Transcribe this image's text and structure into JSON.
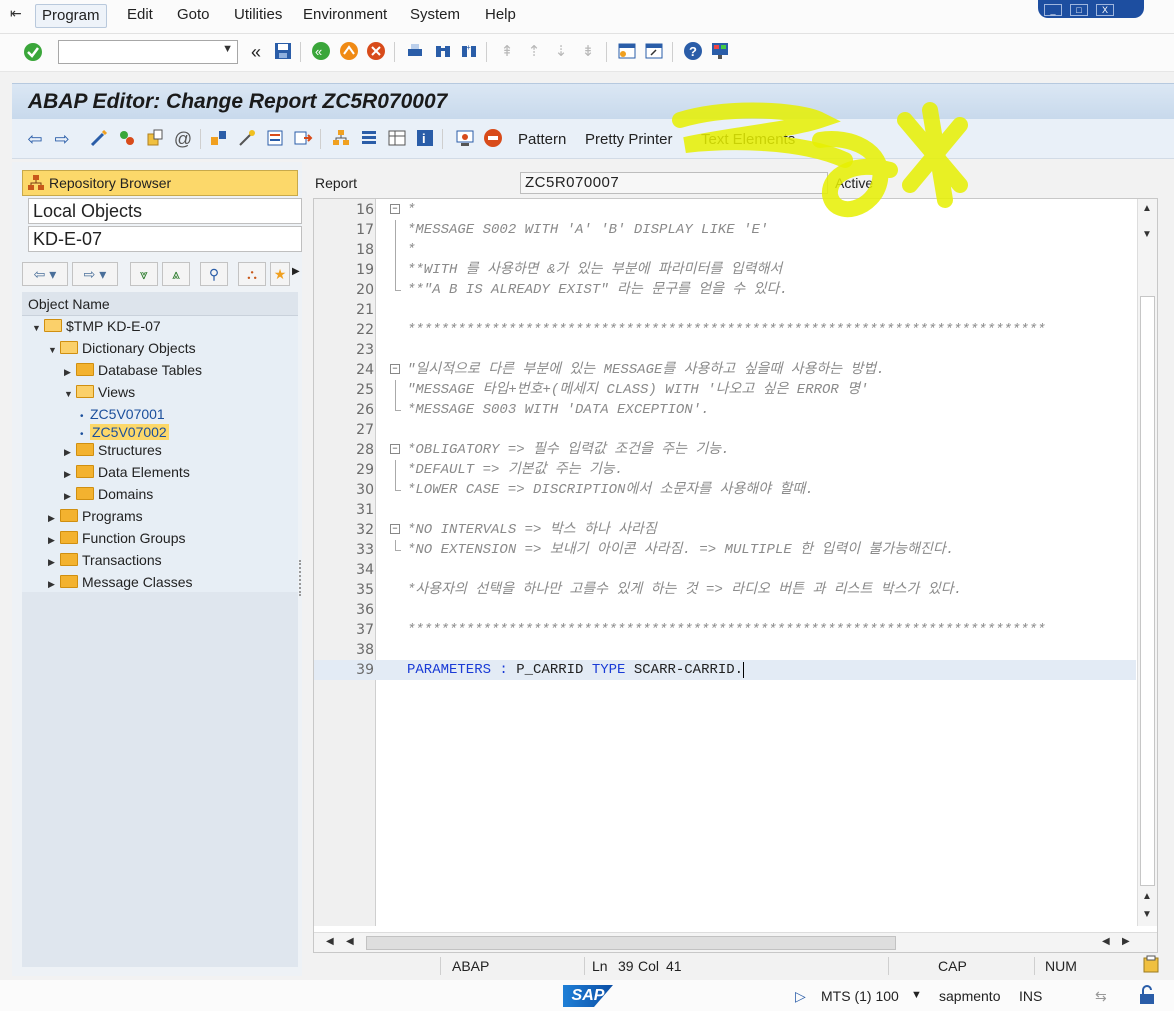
{
  "menubar": {
    "items": [
      "Program",
      "Edit",
      "Goto",
      "Utilities",
      "Environment",
      "System",
      "Help"
    ]
  },
  "window_controls": [
    "_",
    "□",
    "X"
  ],
  "title": "ABAP Editor: Change Report ZC5R070007",
  "app_toolbar": {
    "pattern_label": "Pattern",
    "pretty_printer_label": "Pretty Printer",
    "text_elements_label": "Text Elements"
  },
  "left_panel": {
    "repo_browser_label": "Repository Browser",
    "object_list_type": "Local Objects",
    "object_name_value": "KD-E-07",
    "tree_header": "Object Name",
    "tree": [
      {
        "label": "$TMP KD-E-07",
        "level": 0,
        "state": "expanded",
        "kind": "folder"
      },
      {
        "label": "Dictionary Objects",
        "level": 1,
        "state": "expanded",
        "kind": "folder"
      },
      {
        "label": "Database Tables",
        "level": 2,
        "state": "collapsed",
        "kind": "folder"
      },
      {
        "label": "Views",
        "level": 2,
        "state": "expanded",
        "kind": "folder"
      },
      {
        "label": "ZC5V07001",
        "level": 3,
        "state": "leaf",
        "kind": "item"
      },
      {
        "label": "ZC5V07002",
        "level": 3,
        "state": "leaf",
        "kind": "item",
        "selected": true
      },
      {
        "label": "Structures",
        "level": 2,
        "state": "collapsed",
        "kind": "folder"
      },
      {
        "label": "Data Elements",
        "level": 2,
        "state": "collapsed",
        "kind": "folder"
      },
      {
        "label": "Domains",
        "level": 2,
        "state": "collapsed",
        "kind": "folder"
      },
      {
        "label": "Programs",
        "level": 1,
        "state": "collapsed",
        "kind": "folder"
      },
      {
        "label": "Function Groups",
        "level": 1,
        "state": "collapsed",
        "kind": "folder"
      },
      {
        "label": "Transactions",
        "level": 1,
        "state": "collapsed",
        "kind": "folder"
      },
      {
        "label": "Message Classes",
        "level": 1,
        "state": "collapsed",
        "kind": "folder"
      }
    ]
  },
  "editor": {
    "report_label": "Report",
    "report_name": "ZC5R070007",
    "status": "Active",
    "lines": [
      {
        "n": "16",
        "text": "*",
        "type": "comment",
        "fold": "start"
      },
      {
        "n": "17",
        "text": "*MESSAGE S002 WITH 'A' 'B' DISPLAY LIKE 'E'",
        "type": "comment",
        "fold": "line"
      },
      {
        "n": "18",
        "text": "*",
        "type": "comment",
        "fold": "line"
      },
      {
        "n": "19",
        "text": "**WITH 를 사용하면 &가 있는 부분에 파라미터를 입력해서",
        "type": "comment",
        "fold": "line"
      },
      {
        "n": "20",
        "text": "**\"A B IS ALREADY EXIST\" 라는 문구를 얻을 수 있다.",
        "type": "comment",
        "fold": "end"
      },
      {
        "n": "21",
        "text": "",
        "type": "blank",
        "fold": ""
      },
      {
        "n": "22",
        "text": "****************************************************************************",
        "type": "comment",
        "fold": ""
      },
      {
        "n": "23",
        "text": "",
        "type": "blank",
        "fold": ""
      },
      {
        "n": "24",
        "text": "\"일시적으로 다른 부분에 있는 MESSAGE를 사용하고 싶을때 사용하는 방법.",
        "type": "comment",
        "fold": "start"
      },
      {
        "n": "25",
        "text": "\"MESSAGE 타입+번호+(메세지 CLASS) WITH '나오고 싶은 ERROR 명'",
        "type": "comment",
        "fold": "line"
      },
      {
        "n": "26",
        "text": "*MESSAGE S003 WITH 'DATA EXCEPTION'.",
        "type": "comment",
        "fold": "end"
      },
      {
        "n": "27",
        "text": "",
        "type": "blank",
        "fold": ""
      },
      {
        "n": "28",
        "text": "*OBLIGATORY => 필수 입력값 조건을 주는 기능.",
        "type": "comment",
        "fold": "start"
      },
      {
        "n": "29",
        "text": "*DEFAULT => 기본값 주는 기능.",
        "type": "comment",
        "fold": "line"
      },
      {
        "n": "30",
        "text": "*LOWER CASE => DISCRIPTION에서 소문자를 사용해야 할때.",
        "type": "comment",
        "fold": "end"
      },
      {
        "n": "31",
        "text": "",
        "type": "blank",
        "fold": ""
      },
      {
        "n": "32",
        "text": "*NO INTERVALS => 박스 하나 사라짐",
        "type": "comment",
        "fold": "start"
      },
      {
        "n": "33",
        "text": "*NO EXTENSION => 보내기 아이콘 사라짐. => MULTIPLE 한 입력이 불가능해진다.",
        "type": "comment",
        "fold": "end"
      },
      {
        "n": "34",
        "text": "",
        "type": "blank",
        "fold": ""
      },
      {
        "n": "35",
        "text": "*사용자의 선택을 하나만 고를수 있게 하는 것 => 라디오 버튼 과 리스트 박스가 있다.",
        "type": "comment",
        "fold": ""
      },
      {
        "n": "36",
        "text": "",
        "type": "blank",
        "fold": ""
      },
      {
        "n": "37",
        "text": "****************************************************************************",
        "type": "comment",
        "fold": ""
      },
      {
        "n": "38",
        "text": "",
        "type": "blank",
        "fold": ""
      },
      {
        "n": "39",
        "text": "",
        "type": "code",
        "fold": "",
        "current": true
      }
    ],
    "line39": {
      "kw1": "PARAMETERS",
      "colon": " : ",
      "name": "P_CARRID",
      "kw2": " TYPE",
      "rest": " SCARR-CARRID."
    }
  },
  "editor_status": {
    "language": "ABAP",
    "ln_label": "Ln",
    "ln": "39",
    "col_label": "Col",
    "col": "41",
    "caps": "CAP",
    "num": "NUM"
  },
  "bottom_bar": {
    "logo_text": "SAP",
    "system": "MTS (1) 100",
    "server": "sapmento",
    "mode": "INS"
  },
  "colors": {
    "title_bg": "#c8d9ec",
    "highlight": "#e6f000",
    "keyword": "#1a3bd6",
    "selection": "#fcd86a"
  }
}
